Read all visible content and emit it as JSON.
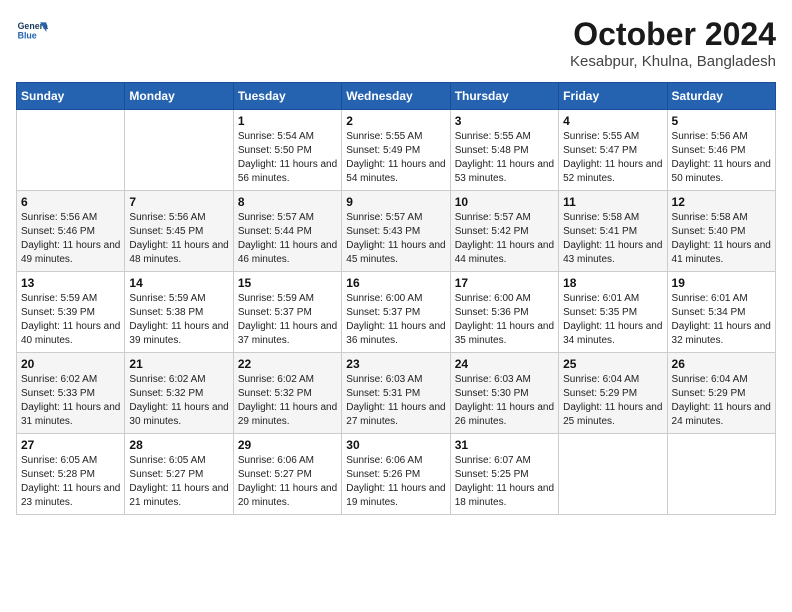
{
  "header": {
    "logo_line1": "General",
    "logo_line2": "Blue",
    "month": "October 2024",
    "location": "Kesabpur, Khulna, Bangladesh"
  },
  "weekdays": [
    "Sunday",
    "Monday",
    "Tuesday",
    "Wednesday",
    "Thursday",
    "Friday",
    "Saturday"
  ],
  "weeks": [
    [
      {
        "day": "",
        "sunrise": "",
        "sunset": "",
        "daylight": ""
      },
      {
        "day": "",
        "sunrise": "",
        "sunset": "",
        "daylight": ""
      },
      {
        "day": "1",
        "sunrise": "Sunrise: 5:54 AM",
        "sunset": "Sunset: 5:50 PM",
        "daylight": "Daylight: 11 hours and 56 minutes."
      },
      {
        "day": "2",
        "sunrise": "Sunrise: 5:55 AM",
        "sunset": "Sunset: 5:49 PM",
        "daylight": "Daylight: 11 hours and 54 minutes."
      },
      {
        "day": "3",
        "sunrise": "Sunrise: 5:55 AM",
        "sunset": "Sunset: 5:48 PM",
        "daylight": "Daylight: 11 hours and 53 minutes."
      },
      {
        "day": "4",
        "sunrise": "Sunrise: 5:55 AM",
        "sunset": "Sunset: 5:47 PM",
        "daylight": "Daylight: 11 hours and 52 minutes."
      },
      {
        "day": "5",
        "sunrise": "Sunrise: 5:56 AM",
        "sunset": "Sunset: 5:46 PM",
        "daylight": "Daylight: 11 hours and 50 minutes."
      }
    ],
    [
      {
        "day": "6",
        "sunrise": "Sunrise: 5:56 AM",
        "sunset": "Sunset: 5:46 PM",
        "daylight": "Daylight: 11 hours and 49 minutes."
      },
      {
        "day": "7",
        "sunrise": "Sunrise: 5:56 AM",
        "sunset": "Sunset: 5:45 PM",
        "daylight": "Daylight: 11 hours and 48 minutes."
      },
      {
        "day": "8",
        "sunrise": "Sunrise: 5:57 AM",
        "sunset": "Sunset: 5:44 PM",
        "daylight": "Daylight: 11 hours and 46 minutes."
      },
      {
        "day": "9",
        "sunrise": "Sunrise: 5:57 AM",
        "sunset": "Sunset: 5:43 PM",
        "daylight": "Daylight: 11 hours and 45 minutes."
      },
      {
        "day": "10",
        "sunrise": "Sunrise: 5:57 AM",
        "sunset": "Sunset: 5:42 PM",
        "daylight": "Daylight: 11 hours and 44 minutes."
      },
      {
        "day": "11",
        "sunrise": "Sunrise: 5:58 AM",
        "sunset": "Sunset: 5:41 PM",
        "daylight": "Daylight: 11 hours and 43 minutes."
      },
      {
        "day": "12",
        "sunrise": "Sunrise: 5:58 AM",
        "sunset": "Sunset: 5:40 PM",
        "daylight": "Daylight: 11 hours and 41 minutes."
      }
    ],
    [
      {
        "day": "13",
        "sunrise": "Sunrise: 5:59 AM",
        "sunset": "Sunset: 5:39 PM",
        "daylight": "Daylight: 11 hours and 40 minutes."
      },
      {
        "day": "14",
        "sunrise": "Sunrise: 5:59 AM",
        "sunset": "Sunset: 5:38 PM",
        "daylight": "Daylight: 11 hours and 39 minutes."
      },
      {
        "day": "15",
        "sunrise": "Sunrise: 5:59 AM",
        "sunset": "Sunset: 5:37 PM",
        "daylight": "Daylight: 11 hours and 37 minutes."
      },
      {
        "day": "16",
        "sunrise": "Sunrise: 6:00 AM",
        "sunset": "Sunset: 5:37 PM",
        "daylight": "Daylight: 11 hours and 36 minutes."
      },
      {
        "day": "17",
        "sunrise": "Sunrise: 6:00 AM",
        "sunset": "Sunset: 5:36 PM",
        "daylight": "Daylight: 11 hours and 35 minutes."
      },
      {
        "day": "18",
        "sunrise": "Sunrise: 6:01 AM",
        "sunset": "Sunset: 5:35 PM",
        "daylight": "Daylight: 11 hours and 34 minutes."
      },
      {
        "day": "19",
        "sunrise": "Sunrise: 6:01 AM",
        "sunset": "Sunset: 5:34 PM",
        "daylight": "Daylight: 11 hours and 32 minutes."
      }
    ],
    [
      {
        "day": "20",
        "sunrise": "Sunrise: 6:02 AM",
        "sunset": "Sunset: 5:33 PM",
        "daylight": "Daylight: 11 hours and 31 minutes."
      },
      {
        "day": "21",
        "sunrise": "Sunrise: 6:02 AM",
        "sunset": "Sunset: 5:32 PM",
        "daylight": "Daylight: 11 hours and 30 minutes."
      },
      {
        "day": "22",
        "sunrise": "Sunrise: 6:02 AM",
        "sunset": "Sunset: 5:32 PM",
        "daylight": "Daylight: 11 hours and 29 minutes."
      },
      {
        "day": "23",
        "sunrise": "Sunrise: 6:03 AM",
        "sunset": "Sunset: 5:31 PM",
        "daylight": "Daylight: 11 hours and 27 minutes."
      },
      {
        "day": "24",
        "sunrise": "Sunrise: 6:03 AM",
        "sunset": "Sunset: 5:30 PM",
        "daylight": "Daylight: 11 hours and 26 minutes."
      },
      {
        "day": "25",
        "sunrise": "Sunrise: 6:04 AM",
        "sunset": "Sunset: 5:29 PM",
        "daylight": "Daylight: 11 hours and 25 minutes."
      },
      {
        "day": "26",
        "sunrise": "Sunrise: 6:04 AM",
        "sunset": "Sunset: 5:29 PM",
        "daylight": "Daylight: 11 hours and 24 minutes."
      }
    ],
    [
      {
        "day": "27",
        "sunrise": "Sunrise: 6:05 AM",
        "sunset": "Sunset: 5:28 PM",
        "daylight": "Daylight: 11 hours and 23 minutes."
      },
      {
        "day": "28",
        "sunrise": "Sunrise: 6:05 AM",
        "sunset": "Sunset: 5:27 PM",
        "daylight": "Daylight: 11 hours and 21 minutes."
      },
      {
        "day": "29",
        "sunrise": "Sunrise: 6:06 AM",
        "sunset": "Sunset: 5:27 PM",
        "daylight": "Daylight: 11 hours and 20 minutes."
      },
      {
        "day": "30",
        "sunrise": "Sunrise: 6:06 AM",
        "sunset": "Sunset: 5:26 PM",
        "daylight": "Daylight: 11 hours and 19 minutes."
      },
      {
        "day": "31",
        "sunrise": "Sunrise: 6:07 AM",
        "sunset": "Sunset: 5:25 PM",
        "daylight": "Daylight: 11 hours and 18 minutes."
      },
      {
        "day": "",
        "sunrise": "",
        "sunset": "",
        "daylight": ""
      },
      {
        "day": "",
        "sunrise": "",
        "sunset": "",
        "daylight": ""
      }
    ]
  ]
}
